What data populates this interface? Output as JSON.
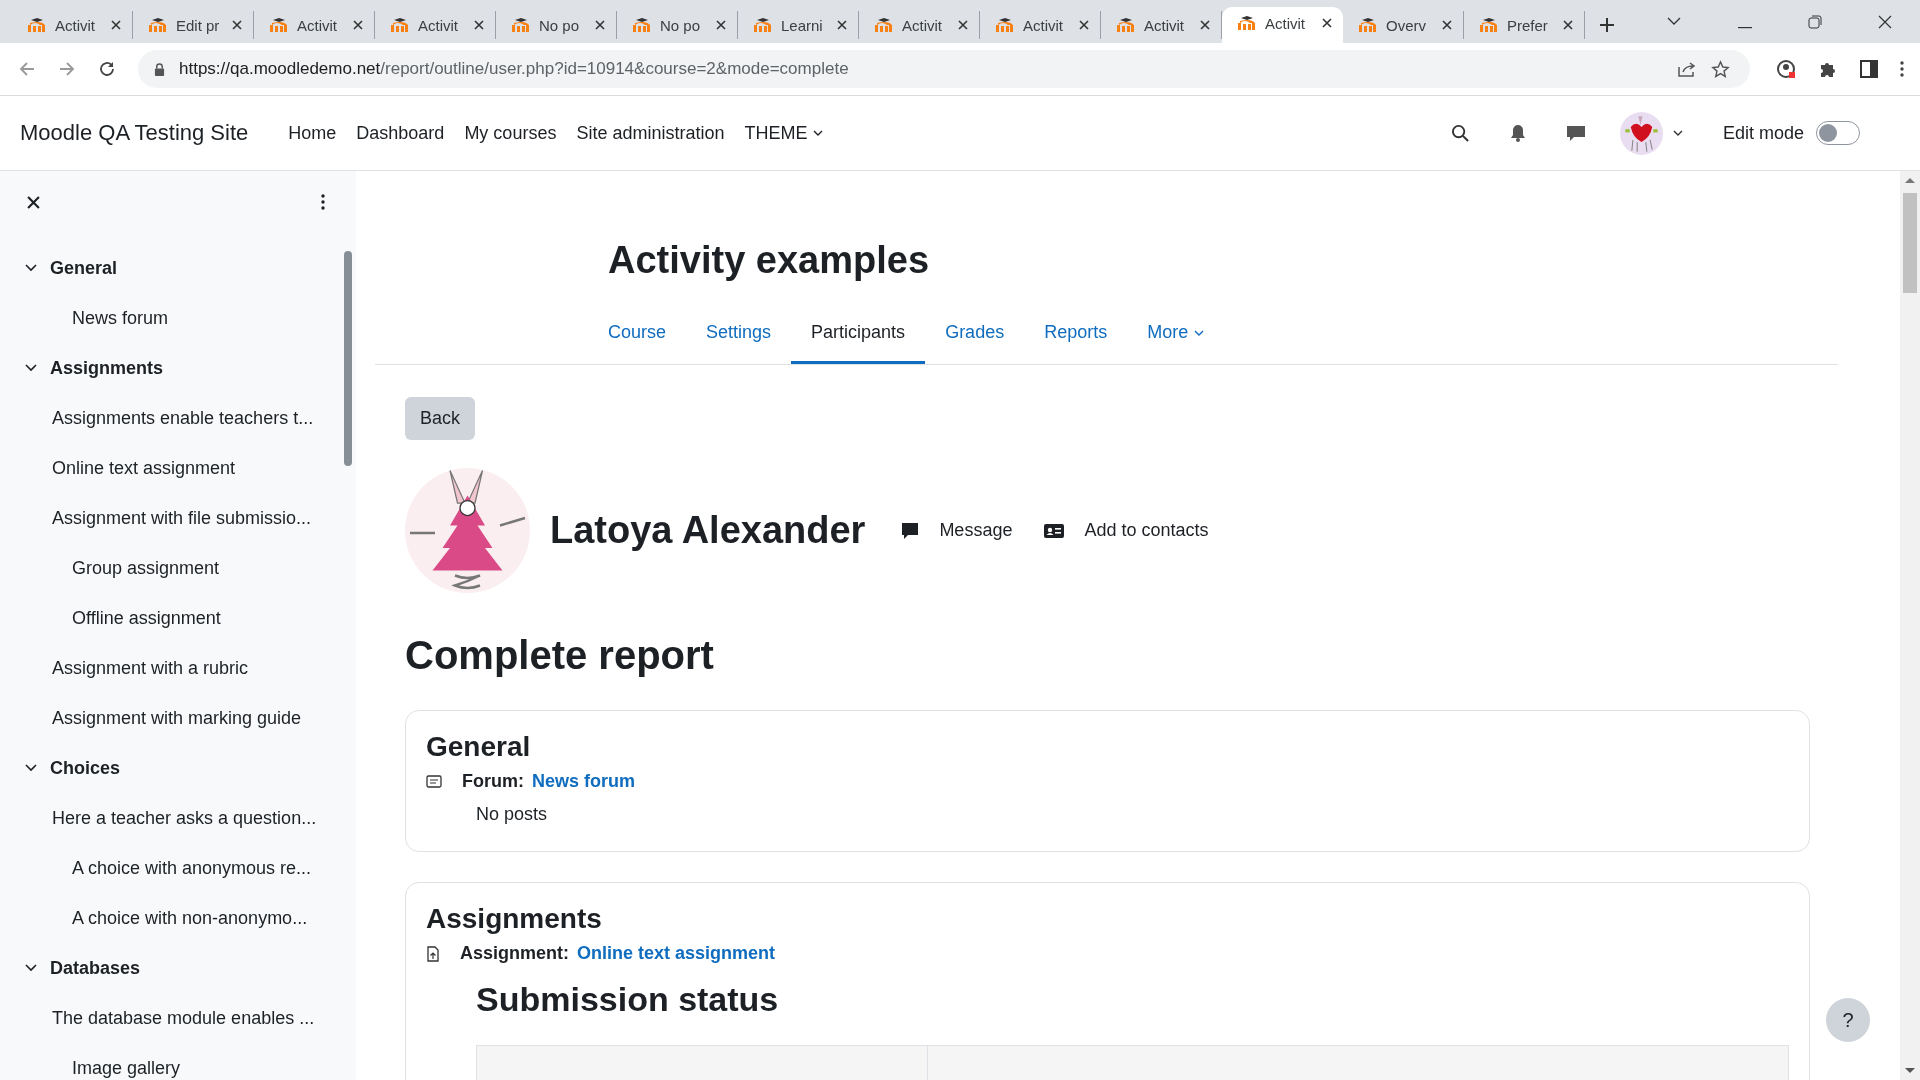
{
  "browser": {
    "tabs": [
      {
        "title": "Activit",
        "selected": false
      },
      {
        "title": "Edit pr",
        "selected": false
      },
      {
        "title": "Activit",
        "selected": false
      },
      {
        "title": "Activit",
        "selected": false
      },
      {
        "title": "No po",
        "selected": false
      },
      {
        "title": "No po",
        "selected": false
      },
      {
        "title": "Learni",
        "selected": false
      },
      {
        "title": "Activit",
        "selected": false
      },
      {
        "title": "Activit",
        "selected": false
      },
      {
        "title": "Activit",
        "selected": false
      },
      {
        "title": "Activit",
        "selected": true
      },
      {
        "title": "Overv",
        "selected": false
      },
      {
        "title": "Prefer",
        "selected": false
      }
    ],
    "url": {
      "host": "https://qa.moodledemo.net",
      "path": "/report/outline/user.php?id=10914&course=2&mode=complete"
    }
  },
  "navbar": {
    "site_name": "Moodle QA Testing Site",
    "links": [
      {
        "label": "Home",
        "kind": "link"
      },
      {
        "label": "Dashboard",
        "kind": "link"
      },
      {
        "label": "My courses",
        "kind": "link"
      },
      {
        "label": "Site administration",
        "kind": "link"
      },
      {
        "label": "THEME",
        "kind": "dropdown"
      }
    ],
    "edit_mode": {
      "label": "Edit mode",
      "on": false
    }
  },
  "sidebar": {
    "sections": [
      {
        "title": "General",
        "expanded": true,
        "items": [
          {
            "label": "News forum",
            "indented": true
          }
        ]
      },
      {
        "title": "Assignments",
        "expanded": true,
        "items": [
          {
            "label": "Assignments enable teachers t...",
            "indented": false
          },
          {
            "label": "Online text assignment",
            "indented": false
          },
          {
            "label": "Assignment with file submissio...",
            "indented": false
          },
          {
            "label": "Group assignment",
            "indented": true
          },
          {
            "label": "Offline assignment",
            "indented": true
          },
          {
            "label": "Assignment with a rubric",
            "indented": false
          },
          {
            "label": "Assignment with marking guide",
            "indented": false
          }
        ]
      },
      {
        "title": "Choices",
        "expanded": true,
        "items": [
          {
            "label": "Here a teacher asks a question...",
            "indented": false
          },
          {
            "label": "A choice with anonymous re...",
            "indented": true
          },
          {
            "label": "A choice with non-anonymo...",
            "indented": true
          }
        ]
      },
      {
        "title": "Databases",
        "expanded": true,
        "items": [
          {
            "label": "The database module enables ...",
            "indented": false
          },
          {
            "label": "Image gallery",
            "indented": true
          }
        ]
      }
    ]
  },
  "course": {
    "title": "Activity examples",
    "tabs": [
      {
        "label": "Course",
        "kind": "link",
        "selected": false
      },
      {
        "label": "Settings",
        "kind": "link",
        "selected": false
      },
      {
        "label": "Participants",
        "kind": "link",
        "selected": true
      },
      {
        "label": "Grades",
        "kind": "link",
        "selected": false
      },
      {
        "label": "Reports",
        "kind": "link",
        "selected": false
      },
      {
        "label": "More",
        "kind": "dropdown",
        "selected": false
      }
    ]
  },
  "back_button": "Back",
  "user": {
    "name": "Latoya Alexander",
    "actions": [
      {
        "label": "Message",
        "kind": "message"
      },
      {
        "label": "Add to contacts",
        "kind": "contact"
      }
    ]
  },
  "report": {
    "title": "Complete report",
    "sections": [
      {
        "title": "General",
        "items": [
          {
            "kind": "forum",
            "type_label": "Forum:",
            "link": "News forum",
            "lines": [
              "No posts"
            ]
          }
        ]
      },
      {
        "title": "Assignments",
        "items": [
          {
            "kind": "assignment",
            "type_label": "Assignment:",
            "link": "Online text assignment",
            "subheading": "Submission status"
          }
        ]
      }
    ]
  },
  "help_button": "?"
}
